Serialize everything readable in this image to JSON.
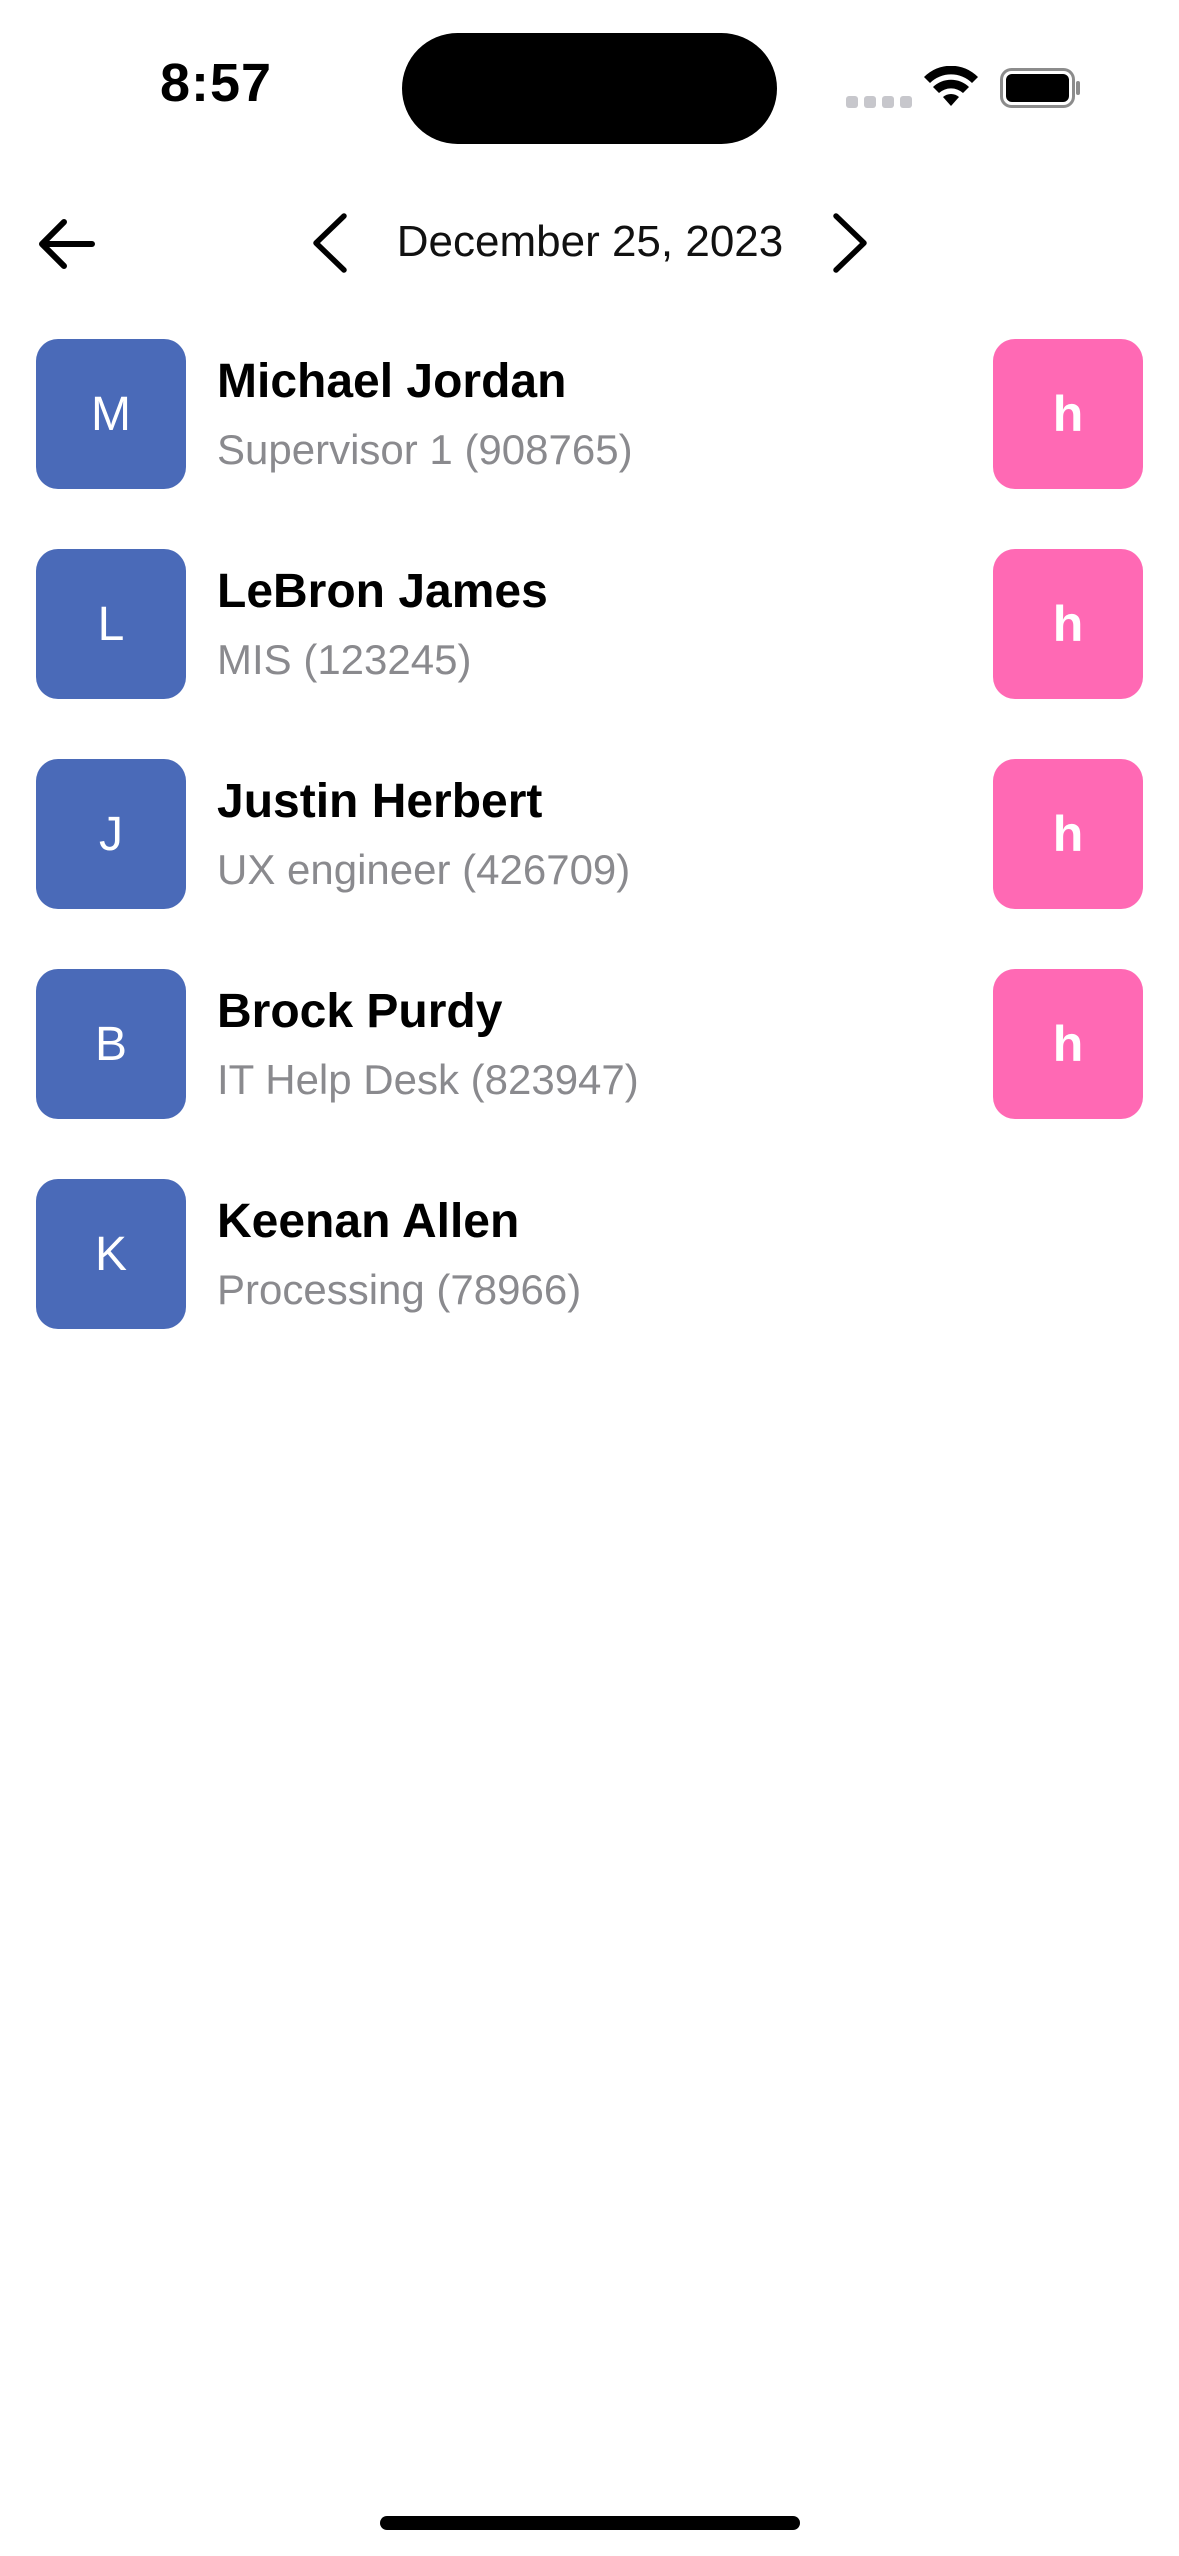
{
  "status_bar": {
    "time": "8:57"
  },
  "header": {
    "date": "December 25, 2023",
    "back_icon": "arrow-left-icon",
    "prev_icon": "chevron-left-icon",
    "next_icon": "chevron-right-icon"
  },
  "colors": {
    "avatar": "#4a6ab8",
    "badge": "#ff69b4",
    "subtitle": "#8a8a8e"
  },
  "employees": [
    {
      "initial": "M",
      "name": "Michael Jordan",
      "subtitle": "Supervisor 1 (908765)",
      "badge": "h"
    },
    {
      "initial": "L",
      "name": "LeBron James",
      "subtitle": "MIS (123245)",
      "badge": "h"
    },
    {
      "initial": "J",
      "name": "Justin Herbert",
      "subtitle": "UX engineer (426709)",
      "badge": "h"
    },
    {
      "initial": "B",
      "name": "Brock Purdy",
      "subtitle": "IT Help Desk (823947)",
      "badge": "h"
    },
    {
      "initial": "K",
      "name": "Keenan Allen",
      "subtitle": "Processing (78966)",
      "badge": null
    }
  ]
}
